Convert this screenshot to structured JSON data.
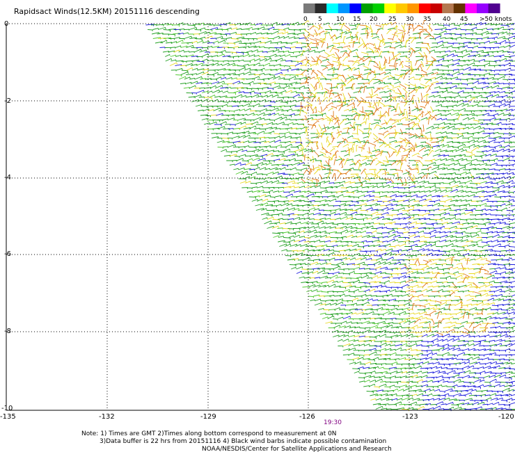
{
  "title": "Rapidsact Winds(12.5KM) 20151116 descending",
  "legend": {
    "labels": [
      "0",
      "5",
      "10",
      "15",
      "20",
      "25",
      "30",
      "35",
      "40",
      "45",
      ">50 knots"
    ],
    "colors": [
      "#7a7a7a",
      "#2b2b2b",
      "#00ffff",
      "#0096ff",
      "#0000ff",
      "#00a000",
      "#00d000",
      "#ffff00",
      "#ffc800",
      "#ff9600",
      "#ff0000",
      "#c80000",
      "#b47850",
      "#643200",
      "#ff00ff",
      "#9600ff",
      "#500090"
    ]
  },
  "axes": {
    "lon_ticks": [
      "-135",
      "-132",
      "-129",
      "-126",
      "-123",
      "-120"
    ],
    "lat_ticks": [
      "0",
      "-2",
      "-4",
      "-6",
      "-8",
      "-10"
    ]
  },
  "swath_time": "19:30",
  "notes": {
    "line1": "Note: 1) Times are GMT 2)Times along bottom correspond to measurement at 0N",
    "line2": "3)Data buffer is 22 hrs from 20151116 4) Black wind barbs indicate possible contamination",
    "line3": "NOAA/NESDIS/Center for Satellite Applications and Research"
  },
  "colors": {
    "grid": "#000000",
    "time_text": "#800080",
    "barb_blue": "#1a1adc",
    "barb_green": "#1e9e1e",
    "barb_lightgreen": "#4cc82a",
    "barb_yellow": "#e8d820",
    "barb_orange": "#e07a1a"
  }
}
